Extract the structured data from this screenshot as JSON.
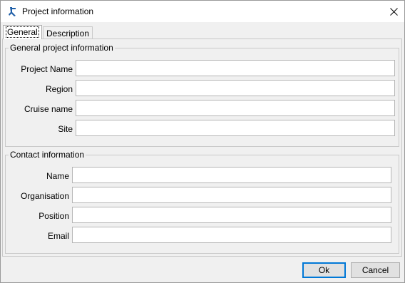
{
  "window": {
    "title": "Project information"
  },
  "tabs": [
    {
      "label": "General",
      "selected": true
    },
    {
      "label": "Description",
      "selected": false
    }
  ],
  "general_group": {
    "legend": "General project information",
    "fields": [
      {
        "label": "Project Name",
        "value": ""
      },
      {
        "label": "Region",
        "value": ""
      },
      {
        "label": "Cruise name",
        "value": ""
      },
      {
        "label": "Site",
        "value": ""
      }
    ]
  },
  "contact_group": {
    "legend": "Contact information",
    "fields": [
      {
        "label": "Name",
        "value": ""
      },
      {
        "label": "Organisation",
        "value": ""
      },
      {
        "label": "Position",
        "value": ""
      },
      {
        "label": "Email",
        "value": ""
      }
    ]
  },
  "buttons": {
    "ok": "Ok",
    "cancel": "Cancel"
  },
  "colors": {
    "accent": "#0078d7",
    "app_icon": "#1f5fa8"
  }
}
